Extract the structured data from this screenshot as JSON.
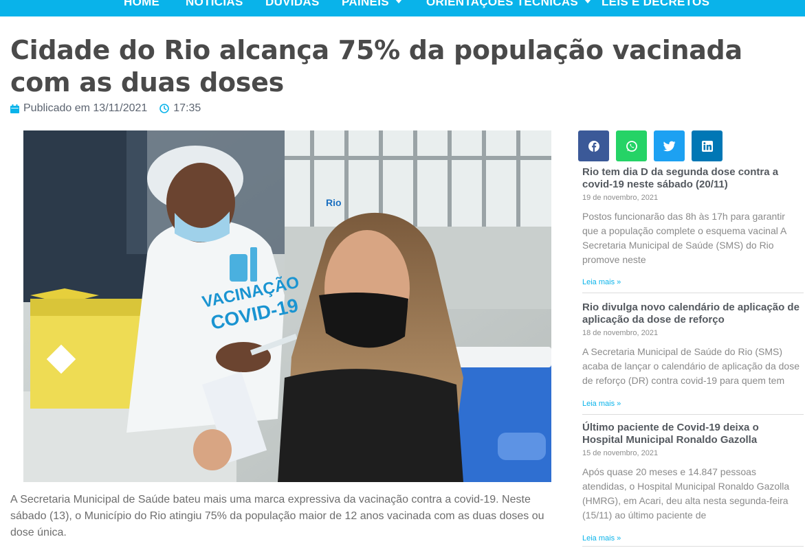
{
  "nav": {
    "items": [
      {
        "label": "HOME",
        "dropdown": false
      },
      {
        "label": "NOTÍCIAS",
        "dropdown": false
      },
      {
        "label": "DÚVIDAS",
        "dropdown": false
      },
      {
        "label": "PAINÉIS",
        "dropdown": true
      },
      {
        "label": "ORIENTAÇÕES TÉCNICAS",
        "dropdown": true
      },
      {
        "label": "LEIS E DECRETOS",
        "dropdown": false
      }
    ],
    "background": "#09b3ea"
  },
  "article": {
    "title": "Cidade do Rio alcança 75% da população vacinada com as duas doses",
    "published_label": "Publicado em 13/11/2021",
    "time": "17:35",
    "image_shirt_text_1": "VACINAÇÃO",
    "image_shirt_text_2": "COVID-19",
    "image_shirt_logo": "Rio",
    "body": "A Secretaria Municipal de Saúde bateu mais uma marca expressiva da vacinação contra a covid-19. Neste sábado (13), o Município do Rio atingiu 75% da população maior de 12 anos vacinada com as duas doses ou dose única."
  },
  "share": [
    {
      "icon": "facebook-icon",
      "color": "#3b5998"
    },
    {
      "icon": "whatsapp-icon",
      "color": "#25d366"
    },
    {
      "icon": "twitter-icon",
      "color": "#1da1f2"
    },
    {
      "icon": "linkedin-icon",
      "color": "#0077b5"
    }
  ],
  "sidebar": {
    "posts": [
      {
        "title": "Rio tem dia D da segunda dose contra a covid-19 neste sábado (20/11)",
        "date": "19 de novembro, 2021",
        "excerpt": "Postos funcionarão das 8h às 17h para garantir que a população complete o esquema vacinal A Secretaria Municipal de Saúde (SMS) do Rio promove neste",
        "more": "Leia mais »"
      },
      {
        "title": "Rio divulga novo calendário de aplicação de aplicação da dose de reforço",
        "date": "18 de novembro, 2021",
        "excerpt": "A Secretaria Municipal de Saúde do Rio (SMS) acaba de lançar o calendário de aplicação da dose de reforço (DR) contra covid-19 para quem tem",
        "more": "Leia mais »"
      },
      {
        "title": "Último paciente de Covid-19 deixa o Hospital Municipal Ronaldo Gazolla",
        "date": "15 de novembro, 2021",
        "excerpt": "Após quase 20 meses e 14.847 pessoas atendidas, o Hospital Municipal Ronaldo Gazolla (HMRG), em Acari, deu alta nesta segunda-feira (15/11) ao último paciente de",
        "more": "Leia mais »"
      }
    ]
  }
}
